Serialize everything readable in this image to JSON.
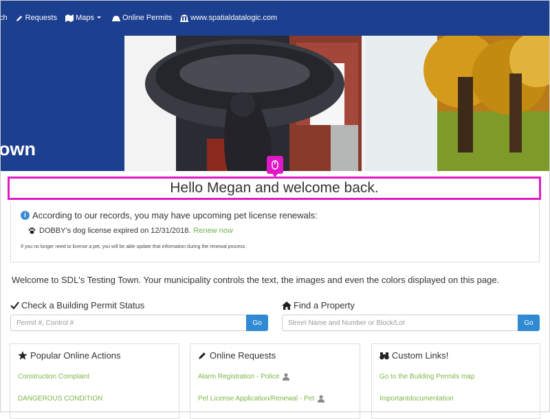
{
  "nav": {
    "items": [
      {
        "label": "ch",
        "icon": "search-icon"
      },
      {
        "label": "Requests",
        "icon": "pencil-icon"
      },
      {
        "label": "Maps",
        "icon": "map-icon"
      },
      {
        "label": "Online Permits",
        "icon": "hard-hat-icon"
      },
      {
        "label": "www.spatialdatalogic.com",
        "icon": "building-icon"
      }
    ]
  },
  "banner": {
    "title": "own"
  },
  "greeting": "Hello Megan and welcome back.",
  "renewal": {
    "heading": "According to our records, you may have upcoming pet license renewals:",
    "item_text": "DOBBY's dog license expired on 12/31/2018.",
    "item_link": "Renew now",
    "note": "If you no longer need to license a pet, you will be able update that information during the renewal process."
  },
  "welcome_text": "Welcome to SDL's Testing Town. Your municipality controls the text, the images and even the colors displayed on this page.",
  "permit_search": {
    "title": "Check a Building Permit Status",
    "placeholder": "Permit #, Control #",
    "button": "Go"
  },
  "property_search": {
    "title": "Find a Property",
    "placeholder": "Street Name and Number or Block/Lot",
    "button": "Go"
  },
  "cards": {
    "popular": {
      "title": "Popular Online Actions",
      "links": [
        "Construction Complaint",
        "DANGEROUS CONDITION"
      ]
    },
    "requests": {
      "title": "Online Requests",
      "links": [
        "Alarm Registration - Police",
        "Pet License Application/Renewal - Pet"
      ]
    },
    "custom": {
      "title": "Custom Links!",
      "links": [
        "Go to the Building Permits map",
        "Importantdocumentation"
      ]
    }
  },
  "colors": {
    "navbar": "#1c3f8f",
    "accent_link": "#7ab648",
    "go_button": "#2f8ad3",
    "highlight": "#e019c7"
  }
}
